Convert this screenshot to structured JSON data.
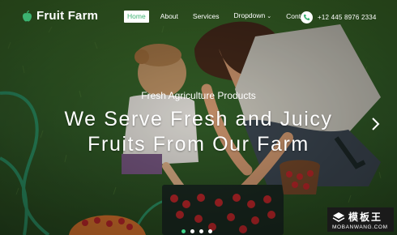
{
  "header": {
    "brand": "Fruit Farm",
    "nav": [
      {
        "label": "Home",
        "active": true
      },
      {
        "label": "About",
        "active": false
      },
      {
        "label": "Services",
        "active": false
      },
      {
        "label": "Dropdown",
        "active": false,
        "has_caret": true
      },
      {
        "label": "Contact",
        "active": false
      }
    ],
    "phone": "+12 445 8976 2334",
    "icons": {
      "brand": "apple-icon",
      "phone": "phone-icon"
    }
  },
  "hero": {
    "kicker": "Fresh Agriculture Products",
    "headline_line1": "We Serve Fresh and Juicy",
    "headline_line2": "Fruits From Our Farm",
    "next_icon": "chevron-right-icon",
    "slides": [
      {
        "active": true
      },
      {
        "active": false
      },
      {
        "active": false
      },
      {
        "active": false
      }
    ]
  },
  "watermark": {
    "title": "模板王",
    "url": "MOBANWANG.COM"
  },
  "colors": {
    "accent": "#3cb371",
    "dot_active": "#3fd28a",
    "text": "#ffffff"
  }
}
